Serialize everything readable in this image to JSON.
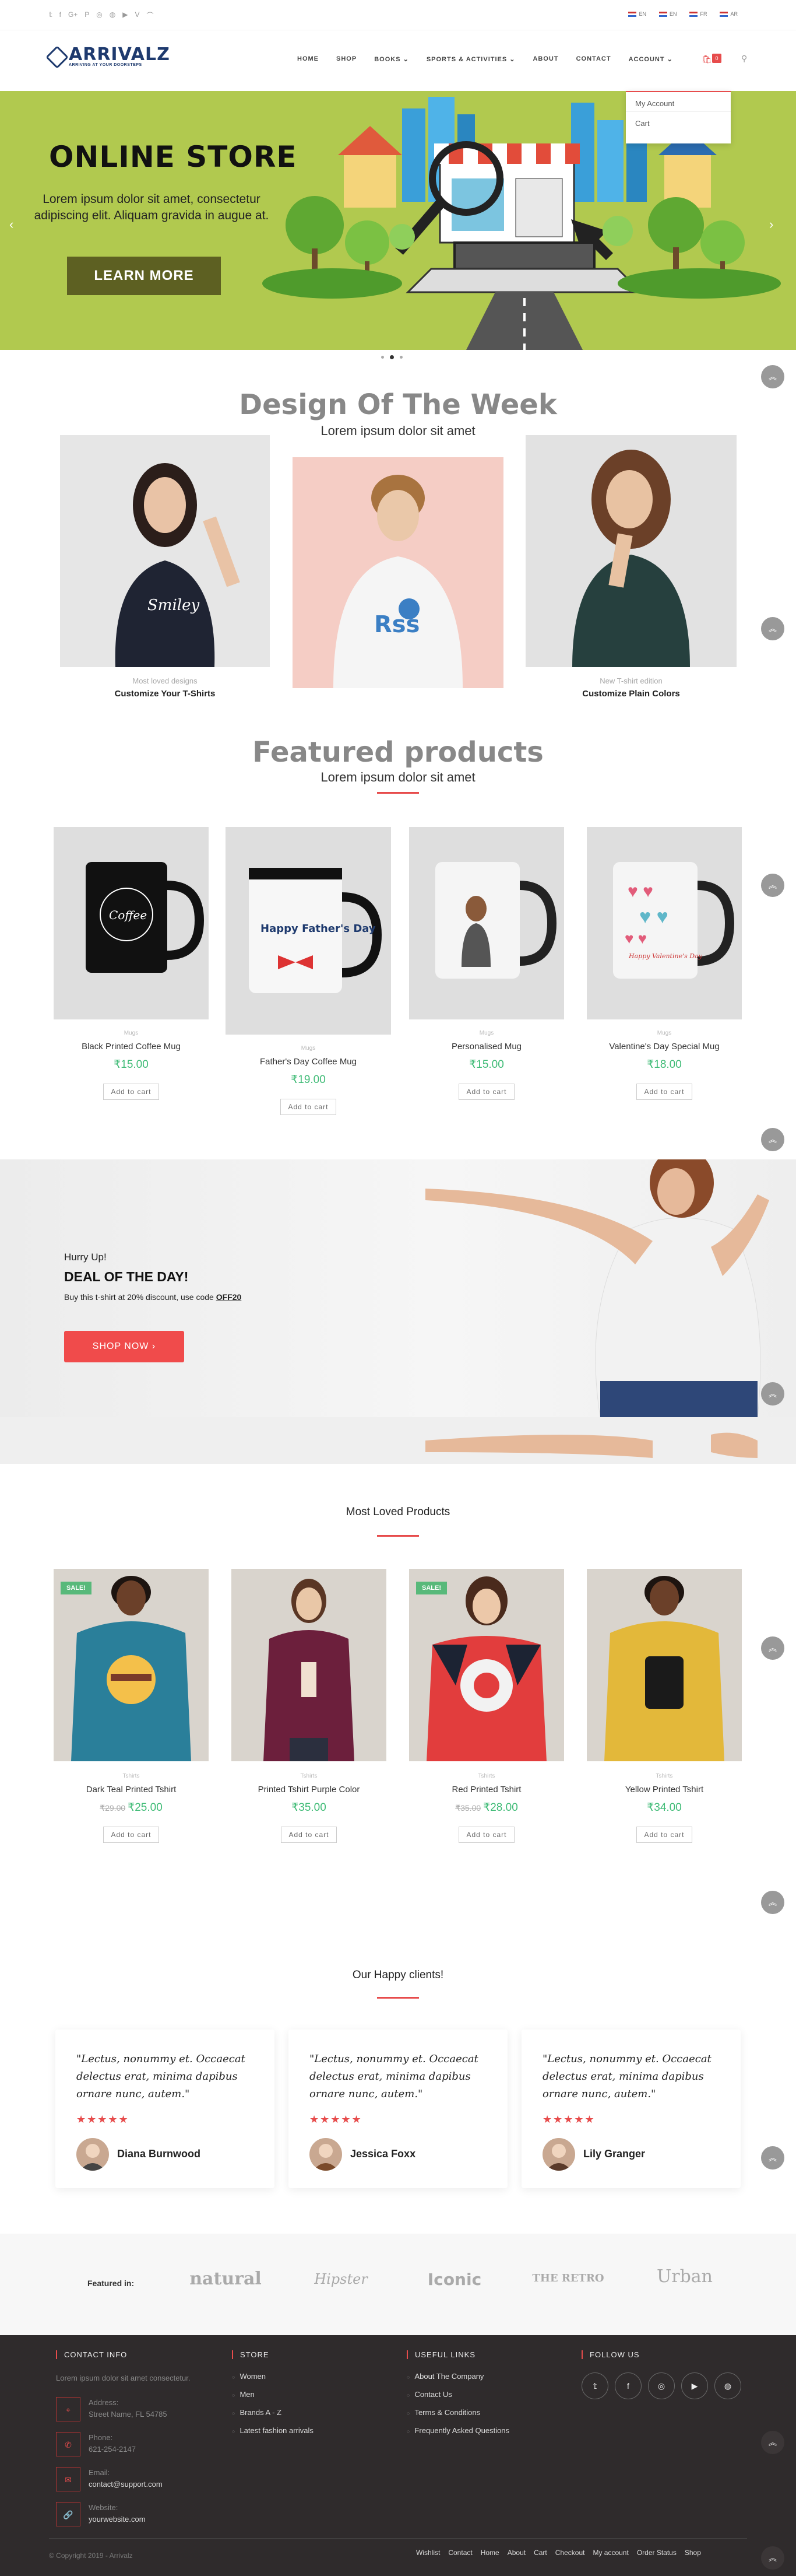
{
  "social_icons": [
    "twitter-icon",
    "facebook-icon",
    "google-plus-icon",
    "pinterest-icon",
    "instagram-icon",
    "dribbble-icon",
    "youtube-icon",
    "vine-icon",
    "rss-icon"
  ],
  "languages": [
    "EN",
    "EN",
    "FR",
    "AR"
  ],
  "logo": {
    "name": "ARRIVALZ",
    "tagline": "ARRIVING AT YOUR DOORSTEPS"
  },
  "nav": [
    "HOME",
    "SHOP",
    "BOOKS",
    "SPORTS & ACTIVITIES",
    "ABOUT",
    "CONTACT",
    "ACCOUNT"
  ],
  "cart_count": "0",
  "account_menu": [
    "My Account",
    "Cart"
  ],
  "hero": {
    "title": "ONLINE STORE",
    "text": "Lorem ipsum dolor sit amet, consectetur adipiscing elit. Aliquam gravida in augue at.",
    "button": "LEARN MORE"
  },
  "design_week": {
    "title": "Design Of The Week",
    "subtitle": "Lorem ipsum dolor sit amet",
    "cards": [
      {
        "small": "Most loved designs",
        "big": "Customize Your T-Shirts"
      },
      {
        "small": "",
        "big": ""
      },
      {
        "small": "New T-shirt edition",
        "big": "Customize Plain Colors"
      }
    ]
  },
  "featured": {
    "title": "Featured products",
    "subtitle": "Lorem ipsum dolor sit amet",
    "items": [
      {
        "cat": "Mugs",
        "name": "Black Printed Coffee Mug",
        "price": "₹15.00"
      },
      {
        "cat": "Mugs",
        "name": "Father's Day Coffee Mug",
        "price": "₹19.00"
      },
      {
        "cat": "Mugs",
        "name": "Personalised Mug",
        "price": "₹15.00"
      },
      {
        "cat": "Mugs",
        "name": "Valentine's Day Special Mug",
        "price": "₹18.00"
      }
    ],
    "add_label": "Add to cart",
    "mug_text": {
      "coffee": "Coffee",
      "fathers": "Happy Father's Day",
      "valentine": "Happy Valentine's Day"
    }
  },
  "deal": {
    "hurry": "Hurry Up!",
    "title": "DEAL OF THE DAY!",
    "text": "Buy this t-shirt at 20% discount, use code ",
    "code": "OFF20",
    "button": "SHOP NOW"
  },
  "most_loved": {
    "title": "Most Loved Products",
    "sale_label": "SALE!",
    "items": [
      {
        "cat": "Tshirts",
        "name": "Dark Teal Printed Tshirt",
        "old": "₹29.00",
        "price": "₹25.00",
        "sale": true
      },
      {
        "cat": "Tshirts",
        "name": "Printed Tshirt Purple Color",
        "old": "",
        "price": "₹35.00",
        "sale": false
      },
      {
        "cat": "Tshirts",
        "name": "Red Printed Tshirt",
        "old": "₹35.00",
        "price": "₹28.00",
        "sale": true
      },
      {
        "cat": "Tshirts",
        "name": "Yellow Printed Tshirt",
        "old": "",
        "price": "₹34.00",
        "sale": false
      }
    ],
    "add_label": "Add to cart"
  },
  "clients": {
    "title": "Our Happy clients!",
    "items": [
      {
        "quote": "\"Lectus, nonummy et. Occaecat delectus erat, minima dapibus ornare nunc, autem.\"",
        "name": "Diana Burnwood"
      },
      {
        "quote": "\"Lectus, nonummy et. Occaecat delectus erat, minima dapibus ornare nunc, autem.\"",
        "name": "Jessica Foxx"
      },
      {
        "quote": "\"Lectus, nonummy et. Occaecat delectus erat, minima dapibus ornare nunc, autem.\"",
        "name": "Lily Granger"
      }
    ],
    "stars": "★★★★★"
  },
  "featured_in": {
    "label": "Featured in:",
    "brands": [
      "natural",
      "Hipster",
      "Iconic",
      "THE RETRO",
      "Urban"
    ]
  },
  "footer": {
    "contact": {
      "title": "CONTACT INFO",
      "text": "Lorem ipsum dolor sit amet consectetur.",
      "address_label": "Address:",
      "address": "Street Name, FL 54785",
      "phone_label": "Phone:",
      "phone": "621-254-2147",
      "email_label": "Email:",
      "email": "contact@support.com",
      "website_label": "Website:",
      "website": "yourwebsite.com"
    },
    "store": {
      "title": "STORE",
      "items": [
        "Women",
        "Men",
        "Brands A - Z",
        "Latest fashion arrivals"
      ]
    },
    "useful": {
      "title": "USEFUL LINKS",
      "items": [
        "About The Company",
        "Contact Us",
        "Terms & Conditions",
        "Frequently Asked Questions"
      ]
    },
    "follow": {
      "title": "FOLLOW US"
    },
    "copyright": "© Copyright 2019 - Arrivalz",
    "bottom_links": [
      "Wishlist",
      "Contact",
      "Home",
      "About",
      "Cart",
      "Checkout",
      "My account",
      "Order Status",
      "Shop"
    ]
  },
  "colors": {
    "accent": "#e74c4c",
    "price_green": "#3fbb76",
    "hero_bg": "#b1c94f",
    "footer_bg": "#2f2b2c",
    "logo": "#1e3a6e"
  }
}
